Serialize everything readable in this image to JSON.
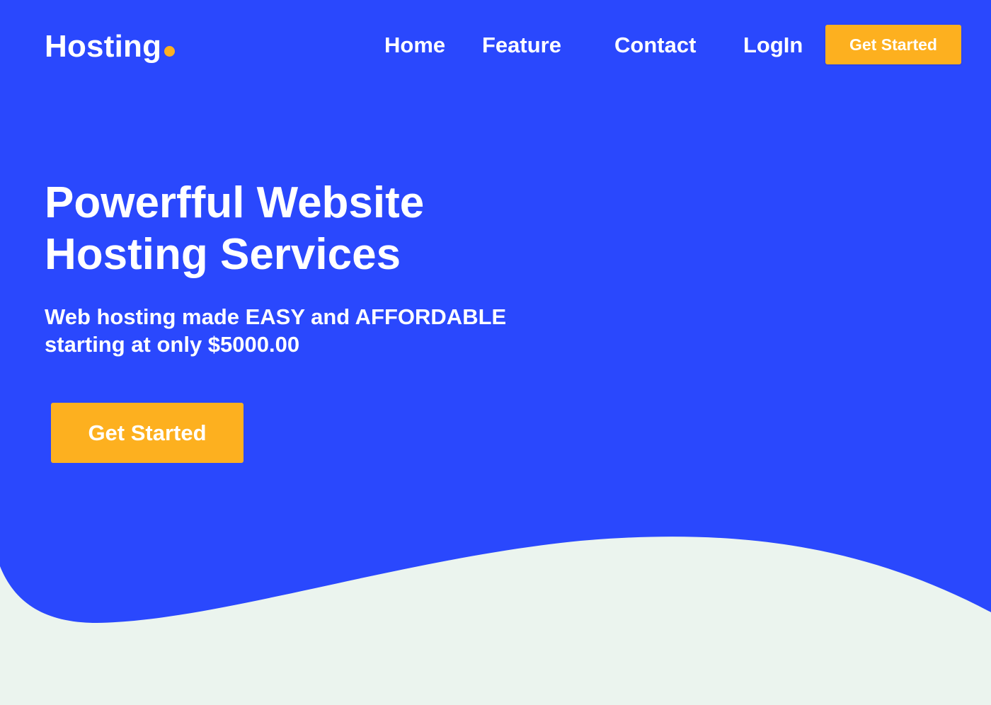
{
  "colors": {
    "background": "#2a48fd",
    "accent": "#fdb01f",
    "wave": "#ebf4ee",
    "text": "#ffffff"
  },
  "header": {
    "logo_text": "Hosting",
    "nav": {
      "home": "Home",
      "feature": "Feature",
      "contact": "Contact",
      "login": "LogIn"
    },
    "cta_label": "Get Started"
  },
  "hero": {
    "title": "Powerfful  Website\nHosting Services",
    "subtitle": "Web hosting made EASY and AFFORDABLE\nstarting at only $5000.00",
    "cta_label": "Get Started"
  }
}
